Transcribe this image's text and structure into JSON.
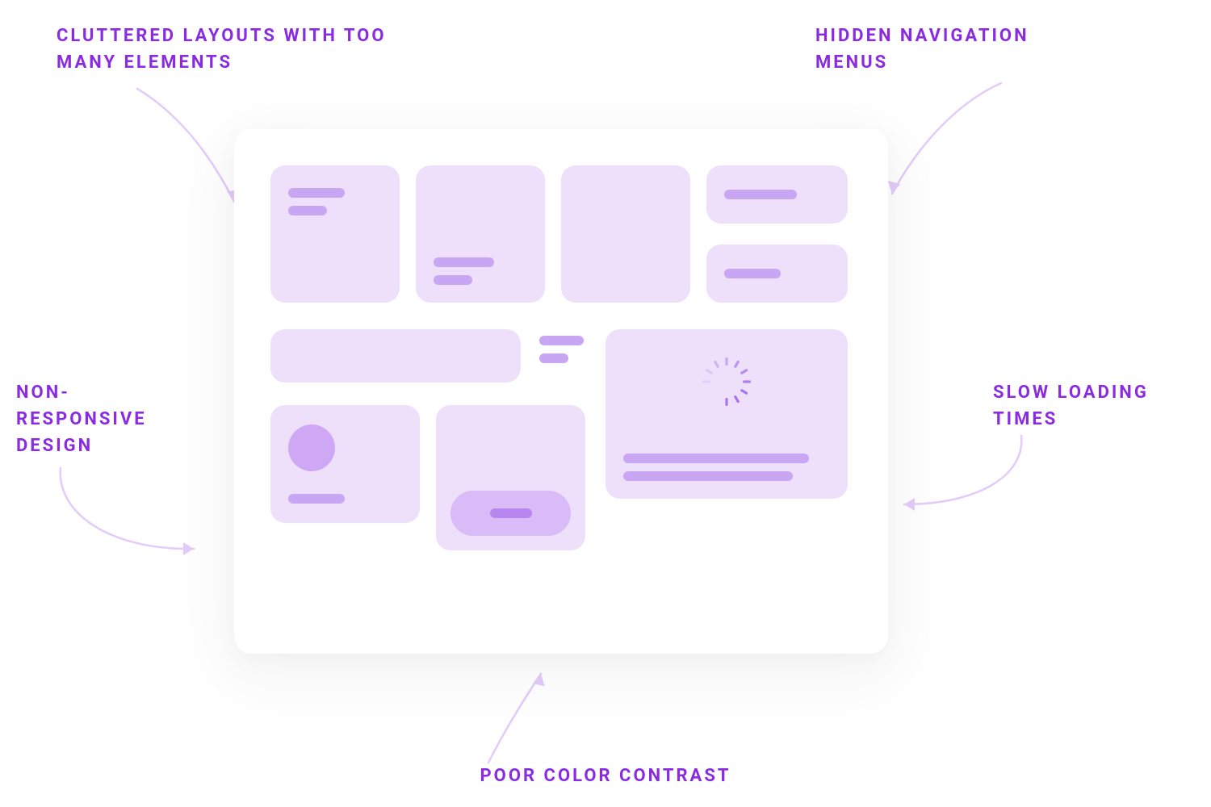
{
  "labels": {
    "top_left": "CLUTTERED LAYOUTS WITH TOO MANY ELEMENTS",
    "top_right": "HIDDEN NAVIGATION MENUS",
    "middle_left": "NON-RESPONSIVE DESIGN",
    "middle_right": "SLOW LOADING TIMES",
    "bottom_center": "POOR COLOR CONTRAST"
  },
  "colors": {
    "label_text": "#8A2BE2",
    "block_fill": "#EEE0FB",
    "accent_bar": "#C9A6F4",
    "arrow": "#E3CBFA",
    "pill_fill": "#D9BBF7",
    "circle_fill": "#CFA8F5"
  },
  "diagram": {
    "type": "annotated-ui-mockup",
    "description": "Central wireframe card illustrating UX antipatterns, with five callout labels and curved arrows pointing inward."
  }
}
